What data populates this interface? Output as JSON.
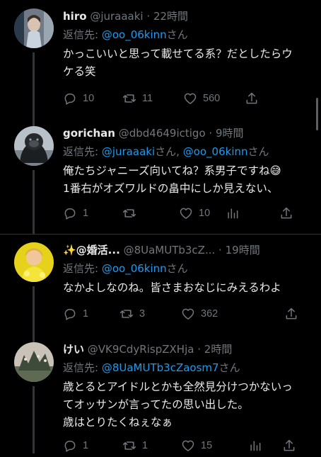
{
  "reply_prefix": "返信先:",
  "sep": "さん",
  "tweets": [
    {
      "name": "hiro",
      "handle": "@juraaaki",
      "dot": "·",
      "time": "22時間",
      "reply_to": [
        "@oo_06kinn"
      ],
      "reply_suffix": "さん",
      "lines": [
        "かっこいいと思って載せてる系？だとしたらウ",
        "ケる笑"
      ],
      "stats": {
        "replies": "10",
        "retweets": "11",
        "likes": "560"
      }
    },
    {
      "name": "gorichan",
      "handle": "@dbd4649ictigo",
      "dot": "·",
      "time": "9時間",
      "reply_to": [
        "@juraaaki",
        "@oo_06kinn"
      ],
      "reply_suffix": "さん",
      "lines": [
        "俺たちジャニーズ向いてね？系男子ですね😅",
        "1番右がオズワルドの畠中にしか見えない、"
      ],
      "stats": {
        "replies": "1",
        "retweets": "",
        "likes": "10"
      }
    },
    {
      "name": "✨@婚活...",
      "handle": "@8UaMUTb3cZ...",
      "dot": "·",
      "time": "19時間",
      "reply_to": [
        "@oo_06kinn"
      ],
      "reply_suffix": "さん",
      "lines": [
        "なかよしなのね。皆さまおなじにみえるわよ"
      ],
      "stats": {
        "replies": "1",
        "retweets": "3",
        "likes": "362"
      }
    },
    {
      "name": "けい",
      "handle": "@VK9CdyRispZXHja",
      "dot": "·",
      "time": "2時間",
      "reply_to": [
        "@8UaMUTb3cZaosm7"
      ],
      "reply_suffix": "さん",
      "lines": [
        "歳とるとアイドルとかも全然見分けつかないっ",
        "てオッサンが言ってたの思い出した。",
        "歳はとりたくねぇなぁ"
      ],
      "stats": {
        "replies": "1",
        "retweets": "1",
        "likes": "15"
      }
    }
  ],
  "icons": [
    "reply-icon",
    "retweet-icon",
    "like-icon",
    "share-icon"
  ],
  "colors": {
    "background": "#000000",
    "text": "#e7e9ea",
    "muted": "#71767b",
    "link": "#1d9bf0"
  }
}
